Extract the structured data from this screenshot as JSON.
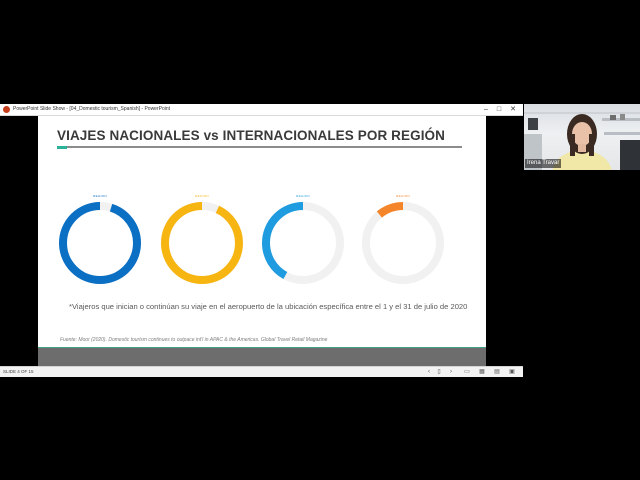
{
  "window": {
    "title": "PowerPoint Slide Show - [04_Domestic tourism_Spanish] - PowerPoint",
    "controls": {
      "minimize": "–",
      "maximize": "□",
      "close": "✕"
    }
  },
  "slide": {
    "title": "VIAJES NACIONALES vs INTERNACIONALES POR REGIÓN",
    "regions": [
      {
        "label": "REGION",
        "color": "#0b6fc4",
        "track_color": "#f1f1f1",
        "fraction": 0.95
      },
      {
        "label": "REGION",
        "color": "#f7b512",
        "track_color": "#f1f1f1",
        "fraction": 0.93
      },
      {
        "label": "REGION",
        "color": "#1f9bdf",
        "track_color": "#f1f1f1",
        "fraction": 0.42
      },
      {
        "label": "REGION",
        "color": "#f5852b",
        "track_color": "#f1f1f1",
        "fraction": 0.11
      }
    ],
    "footnote": "*Viajeros que inician o continúan su viaje en el aeropuerto de la ubicación específica entre el 1 y el 31 de julio de 2020",
    "source": "Fuente: Moor (2020). Domestic tourism continues to outpace int'l in APAC & the Americas. Global Travel Retail Magazine"
  },
  "statusbar": {
    "slide_counter": "SLIDE 4 OF 15"
  },
  "webcam": {
    "participant_name": "Irena Travar"
  }
}
